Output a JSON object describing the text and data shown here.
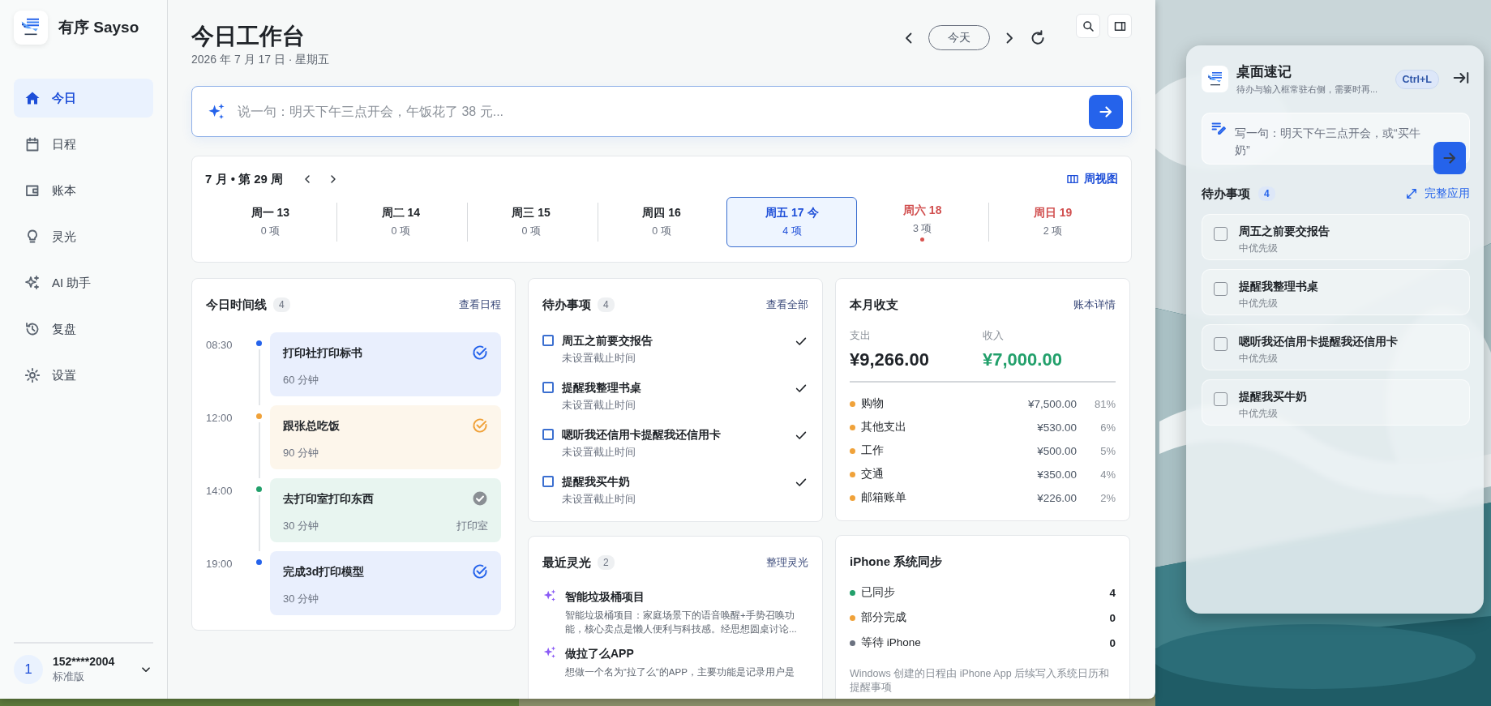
{
  "app": {
    "name": "有序 Sayso"
  },
  "sidebar": {
    "items": [
      {
        "label": "今日",
        "selected": true
      },
      {
        "label": "日程",
        "selected": false
      },
      {
        "label": "账本",
        "selected": false
      },
      {
        "label": "灵光",
        "selected": false
      },
      {
        "label": "AI 助手",
        "selected": false
      },
      {
        "label": "复盘",
        "selected": false
      },
      {
        "label": "设置",
        "selected": false
      }
    ],
    "account": {
      "avatar": "1",
      "name": "152****2004",
      "plan": "标准版"
    }
  },
  "header": {
    "title": "今日工作台",
    "date": "2026 年 7 月 17 日 · 星期五",
    "today_button": "今天"
  },
  "command": {
    "placeholder": "说一句：明天下午三点开会，午饭花了 38 元..."
  },
  "week": {
    "title": "7 月 • 第 29 周",
    "view_link": "周视图",
    "days": [
      {
        "label": "周一 13",
        "count": "0 项",
        "selected": false,
        "weekend": false,
        "dot": false
      },
      {
        "label": "周二 14",
        "count": "0 项",
        "selected": false,
        "weekend": false,
        "dot": false
      },
      {
        "label": "周三 15",
        "count": "0 项",
        "selected": false,
        "weekend": false,
        "dot": false
      },
      {
        "label": "周四 16",
        "count": "0 项",
        "selected": false,
        "weekend": false,
        "dot": false
      },
      {
        "label": "周五 17 今",
        "count": "4 项",
        "selected": true,
        "weekend": false,
        "dot": false
      },
      {
        "label": "周六 18",
        "count": "3 项",
        "selected": false,
        "weekend": true,
        "dot": true
      },
      {
        "label": "周日 19",
        "count": "2 项",
        "selected": false,
        "weekend": true,
        "dot": false
      }
    ]
  },
  "timeline": {
    "title": "今日时间线",
    "count": "4",
    "link": "查看日程",
    "events": [
      {
        "time": "08:30",
        "title": "打印社打印标书",
        "duration": "60 分钟",
        "color": "#2563eb",
        "done": false
      },
      {
        "time": "12:00",
        "title": "跟张总吃饭",
        "duration": "90 分钟",
        "color": "#f0a23a",
        "done": false
      },
      {
        "time": "14:00",
        "title": "去打印室打印东西",
        "duration": "30 分钟",
        "location": "打印室",
        "color": "#22a06b",
        "done": true
      },
      {
        "time": "19:00",
        "title": "完成3d打印模型",
        "duration": "30 分钟",
        "color": "#2563eb",
        "done": false
      }
    ]
  },
  "todos": {
    "title": "待办事项",
    "count": "4",
    "link": "查看全部",
    "items": [
      {
        "title": "周五之前要交报告",
        "note": "未设置截止时间",
        "checked": false
      },
      {
        "title": "提醒我整理书桌",
        "note": "未设置截止时间",
        "checked": false
      },
      {
        "title": "嗯听我还信用卡提醒我还信用卡",
        "note": "未设置截止时间",
        "checked": false
      },
      {
        "title": "提醒我买牛奶",
        "note": "未设置截止时间",
        "checked": false
      }
    ]
  },
  "ideas": {
    "title": "最近灵光",
    "count": "2",
    "link": "整理灵光",
    "items": [
      {
        "title": "智能垃圾桶项目",
        "text": "智能垃圾桶项目：家庭场景下的语音唤醒+手势召唤功能，核心卖点是懒人便利与科技感。经思想圆桌讨论..."
      },
      {
        "title": "做拉了么APP",
        "text": "想做一个名为“拉了么”的APP，主要功能是记录用户是"
      }
    ]
  },
  "ledger": {
    "title": "本月收支",
    "link": "账本详情",
    "expense_label": "支出",
    "expense": "¥9,266.00",
    "income_label": "收入",
    "income": "¥7,000.00",
    "categories": [
      {
        "name": "购物",
        "amount": "¥7,500.00",
        "percent": "81%"
      },
      {
        "name": "其他支出",
        "amount": "¥530.00",
        "percent": "6%"
      },
      {
        "name": "工作",
        "amount": "¥500.00",
        "percent": "5%"
      },
      {
        "name": "交通",
        "amount": "¥350.00",
        "percent": "4%"
      },
      {
        "name": "邮箱账单",
        "amount": "¥226.00",
        "percent": "2%"
      }
    ]
  },
  "sync": {
    "title": "iPhone 系统同步",
    "rows": [
      {
        "label": "已同步",
        "count": "4",
        "color": "#22a06b"
      },
      {
        "label": "部分完成",
        "count": "0",
        "color": "#f0a23a"
      },
      {
        "label": "等待 iPhone",
        "count": "0",
        "color": "#6b7280"
      }
    ],
    "note": "Windows 创建的日程由 iPhone App 后续写入系统日历和提醒事项"
  },
  "quick_panel": {
    "title": "桌面速记",
    "subtitle": "待办与输入框常驻右侧，需要时再...",
    "shortcut": "Ctrl+L",
    "placeholder": "写一句：明天下午三点开会，或“买牛奶”",
    "todo_title": "待办事项",
    "todo_count": "4",
    "link": "完整应用",
    "items": [
      {
        "title": "周五之前要交报告",
        "priority": "中优先级",
        "checked": false
      },
      {
        "title": "提醒我整理书桌",
        "priority": "中优先级",
        "checked": false
      },
      {
        "title": "嗯听我还信用卡提醒我还信用卡",
        "priority": "中优先级",
        "checked": false
      },
      {
        "title": "提醒我买牛奶",
        "priority": "中优先级",
        "checked": false
      }
    ]
  }
}
